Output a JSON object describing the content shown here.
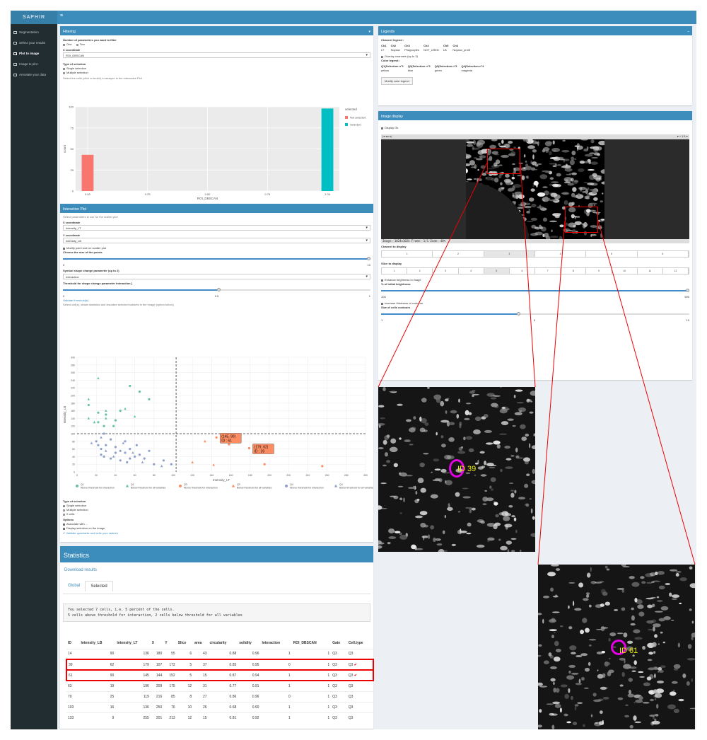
{
  "app": {
    "logo": "SAPHIR",
    "menu_icon": "hamburger-icon"
  },
  "sidebar": {
    "items": [
      {
        "label": "Segmentation"
      },
      {
        "label": "Select your results"
      },
      {
        "label": "Plot to image"
      },
      {
        "label": "Image to plot"
      },
      {
        "label": "Annotate your data"
      }
    ]
  },
  "filtering": {
    "title": "Filtering",
    "num_params_label": "Number of parameters you want to filter",
    "opt_one": "One",
    "opt_two": "Two",
    "x_label": "X coordinate",
    "x_value": "ROI_DBSCAN",
    "type_label": "Type of selection",
    "single": "Single selection",
    "multiple": "Multiple selection",
    "hint": "Select the cells (click or brush) to analyze in the interactive Plot",
    "legend_title": "selected",
    "legend_not": "Not selected",
    "legend_sel": "Selected",
    "colors": {
      "not": "#f8766d",
      "sel": "#00bfc4"
    }
  },
  "hist": {
    "chart_data": {
      "type": "bar",
      "x": [
        0,
        1
      ],
      "values": [
        43,
        98
      ],
      "series_names": [
        "Not selected",
        "Selected"
      ],
      "xlabel": "ROI_DBSCAN",
      "ylabel": "count",
      "xlim": [
        -0.05,
        1.05
      ],
      "ylim": [
        0,
        100
      ],
      "yticks": [
        0,
        25,
        50,
        75,
        100
      ],
      "xticks": [
        "0.00",
        "0.25",
        "0.50",
        "0.75",
        "1.00"
      ]
    }
  },
  "interactive": {
    "title": "Interactive Plot",
    "hint": "Select parameters to use for the scatter plot",
    "x_label": "X coordinate",
    "x_value": "Intensity_LT",
    "y_label": "Y coordinate",
    "y_value": "Intensity_LB",
    "modify_check": "Modify point size on scatter plot",
    "size_label": "Choose the size of the points",
    "size_min": "0",
    "size_max": "10",
    "symbol_label": "Symbol shape change parameter (up to 2)",
    "symbol_value": "Interaction",
    "thresh_label": "Threshold for shape change parameter Interaction [",
    "thresh_min": "0",
    "thresh_max": "1",
    "thresh_val": "0.5",
    "validate": "Validate threshold(s)",
    "validate_hint": "Select cell(s), obtain statistics and visualize selected subsets in the image (option below)",
    "sel_type_label": "Type of selection",
    "r_single": "Single selection",
    "r_multiple": "Multiple selection",
    "r_zones": "2 cells",
    "options_label": "Options",
    "opt1": "Associate with ...",
    "opt2": "Display selection on the image",
    "validate_btn": "Validate quadrants and write your statues"
  },
  "scatter": {
    "chart_data": {
      "type": "scatter",
      "xlabel": "Intensity_LT",
      "ylabel": "Intensity_LB",
      "xlim": [
        0,
        300
      ],
      "ylim": [
        0,
        300
      ],
      "xticks": [
        0,
        20,
        40,
        60,
        80,
        100,
        120,
        140,
        160,
        180,
        200,
        220,
        240,
        260,
        280,
        300
      ],
      "yticks": [
        0,
        20,
        40,
        60,
        80,
        100,
        120,
        140,
        160,
        180,
        200,
        220,
        240,
        260,
        280,
        300
      ],
      "vline": 103,
      "hline": 100,
      "series": [
        {
          "name": "Q1 Above threshold for Interaction",
          "color": "#66c2a5",
          "shape": "circle",
          "points": [
            [
              12,
              175
            ],
            [
              22,
              155
            ],
            [
              22,
              130
            ],
            [
              30,
              150
            ],
            [
              40,
              135
            ],
            [
              45,
              160
            ],
            [
              55,
              225
            ],
            [
              65,
              210
            ],
            [
              75,
              190
            ],
            [
              28,
              120
            ],
            [
              38,
              120
            ]
          ]
        },
        {
          "name": "Q1 Below threshold for all variables",
          "color": "#66c2a5",
          "shape": "triangle",
          "points": [
            [
              12,
              190
            ],
            [
              22,
              245
            ],
            [
              30,
              160
            ],
            [
              30,
              140
            ],
            [
              50,
              165
            ],
            [
              60,
              145
            ],
            [
              12,
              140
            ],
            [
              18,
              130
            ]
          ]
        },
        {
          "name": "Q3 Above threshold for Interaction",
          "color": "#fc8d62",
          "shape": "circle",
          "points": [
            [
              145,
              90
            ],
            [
              179,
              62
            ],
            [
              158,
              72
            ],
            [
              195,
              20
            ],
            [
              255,
              15
            ]
          ]
        },
        {
          "name": "Q3 Below threshold for all variables",
          "color": "#fc8d62",
          "shape": "triangle",
          "points": [
            [
              120,
              25
            ],
            [
              133,
              80
            ],
            [
              161,
              80
            ],
            [
              142,
              18
            ]
          ]
        },
        {
          "name": "Q4 Above threshold for Interaction",
          "color": "#8da0cb",
          "shape": "circle",
          "points": [
            [
              20,
              80
            ],
            [
              25,
              60
            ],
            [
              25,
              45
            ],
            [
              28,
              100
            ],
            [
              30,
              70
            ],
            [
              35,
              35
            ],
            [
              40,
              50
            ],
            [
              45,
              55
            ],
            [
              50,
              80
            ],
            [
              52,
              25
            ],
            [
              55,
              60
            ],
            [
              60,
              40
            ],
            [
              62,
              70
            ],
            [
              70,
              35
            ],
            [
              80,
              20
            ],
            [
              90,
              30
            ],
            [
              98,
              20
            ],
            [
              22,
              70
            ],
            [
              28,
              40
            ],
            [
              35,
              85
            ],
            [
              40,
              65
            ],
            [
              45,
              30
            ],
            [
              50,
              50
            ],
            [
              55,
              35
            ],
            [
              65,
              45
            ],
            [
              75,
              55
            ]
          ]
        },
        {
          "name": "Q4 Below threshold for all variables",
          "color": "#8da0cb",
          "shape": "triangle",
          "points": [
            [
              15,
              75
            ],
            [
              25,
              90
            ],
            [
              30,
              55
            ],
            [
              38,
              40
            ],
            [
              48,
              75
            ],
            [
              58,
              50
            ],
            [
              68,
              25
            ],
            [
              88,
              15
            ]
          ]
        }
      ]
    },
    "labels": [
      {
        "text1": "(145, 90)",
        "text2": "ID : 61"
      },
      {
        "text1": "(179, 62)",
        "text2": "ID : 39"
      }
    ]
  },
  "legends": {
    "title": "Legends",
    "channel_title": "Channel legend :",
    "channels": [
      {
        "h": "Ch1",
        "v": "LT"
      },
      {
        "h": "Ch2",
        "v": "Noyaux"
      },
      {
        "h": "Ch3",
        "v": "Phagocytes"
      },
      {
        "h": "Ch4",
        "v": "NOT_USED"
      },
      {
        "h": "Ch5",
        "v": "LB"
      },
      {
        "h": "Ch6",
        "v": "Noyaux_prolif"
      }
    ],
    "overlay": "Overlay channels (up to 3)",
    "color_title": "Color legend :",
    "colors": [
      {
        "h": "Q1(Selection n°1",
        "v": "yellow"
      },
      {
        "h": "Q2(Selection n°2",
        "v": "blue"
      },
      {
        "h": "Q3(Selection n°3",
        "v": "green"
      },
      {
        "h": "Q4(Selection n°4",
        "v": "magenta"
      }
    ],
    "modify_btn": "Modify color legend"
  },
  "image_display": {
    "title": "Image display",
    "display_check": "Display Ok",
    "status": "Image: 1024x1024  Frame: 1/1  Zoom: 40%",
    "channel_label": "Channel to display",
    "channels": [
      "1",
      "2",
      "3",
      "4",
      "5",
      "6"
    ],
    "channel_selected": "3",
    "slice_label": "Slice to display",
    "slices": [
      "1",
      "2",
      "3",
      "4",
      "5",
      "6",
      "7",
      "8",
      "9",
      "10",
      "11",
      "12"
    ],
    "slice_selected": "5",
    "enhance": "Enhance brightness in image",
    "bright_label": "% of initial brightness",
    "bright_min": "100",
    "bright_max": "500",
    "bright_val": "500",
    "increase": "Increase thickness of contours",
    "size_label": "Size of cells contours",
    "size_min": "1",
    "size_max": "10",
    "size_val": "5"
  },
  "stats": {
    "title": "Statistics",
    "download": "Download results",
    "tabs": [
      "Global",
      "Selected"
    ],
    "active_tab": "Selected",
    "msg1": "You selected 7 cells, i.e.  5  percent of the cells.",
    "msg2": " 5 cells above threshold for  interaction, 2 cells below threshold for all variables",
    "headers": [
      "ID",
      "Intensity_LB",
      "Intensity_LT",
      "X",
      "Y",
      "Slice",
      "area",
      "circularity",
      "solidity",
      "Interaction",
      "ROI_DBSCAN",
      "Gate",
      "Cell.type"
    ],
    "rows": [
      [
        "14",
        "90",
        "136",
        "180",
        "55",
        "6",
        "43",
        "0.88",
        "0.96",
        "1",
        "1",
        "Q3",
        "Q3"
      ],
      [
        "39",
        "62",
        "179",
        "107",
        "172",
        "5",
        "37",
        "0.85",
        "0.95",
        "0",
        "1",
        "Q3",
        "Q3"
      ],
      [
        "61",
        "90",
        "145",
        "144",
        "152",
        "5",
        "15",
        "0.87",
        "0.94",
        "1",
        "1",
        "Q3",
        "Q3"
      ],
      [
        "63",
        "19",
        "196",
        "209",
        "175",
        "12",
        "31",
        "0.77",
        "0.91",
        "1",
        "1",
        "Q3",
        "Q3"
      ],
      [
        "70",
        "25",
        "119",
        "216",
        "85",
        "8",
        "27",
        "0.86",
        "0.96",
        "0",
        "1",
        "Q3",
        "Q3"
      ],
      [
        "103",
        "16",
        "136",
        "250",
        "76",
        "10",
        "26",
        "0.68",
        "0.90",
        "1",
        "1",
        "Q3",
        "Q3"
      ],
      [
        "133",
        "9",
        "255",
        "201",
        "213",
        "12",
        "15",
        "0.81",
        "0.92",
        "1",
        "1",
        "Q3",
        "Q3"
      ]
    ],
    "highlight_ids": [
      "39",
      "61"
    ]
  },
  "zoom1": {
    "label": "ID 39"
  },
  "zoom2": {
    "label": "ID 61"
  }
}
